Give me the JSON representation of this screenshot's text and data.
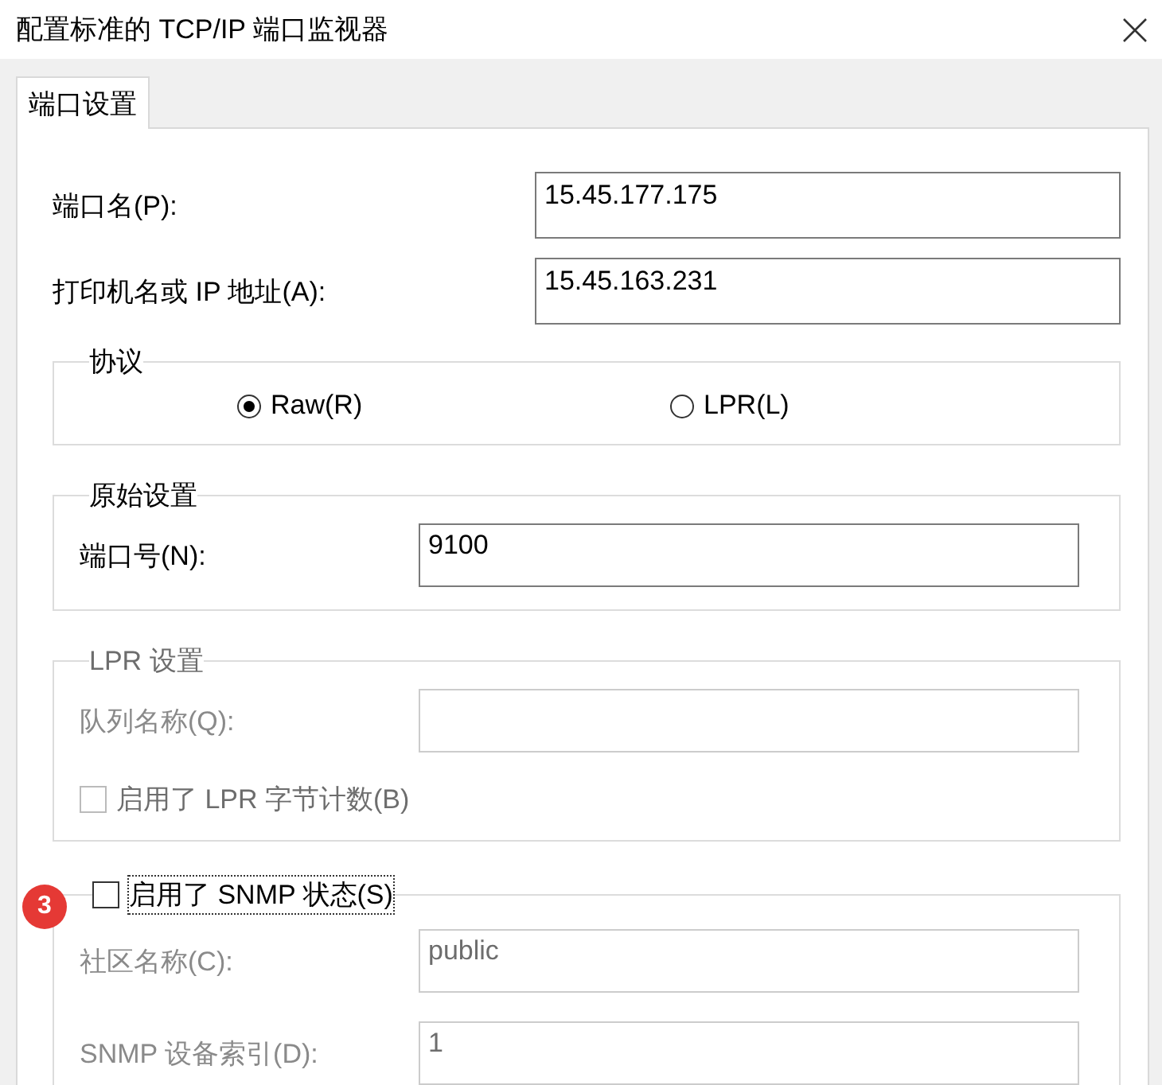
{
  "window": {
    "title": "配置标准的 TCP/IP 端口监视器"
  },
  "tabs": [
    {
      "label": "端口设置",
      "selected": true
    }
  ],
  "fields": [
    {
      "label": "端口名(P):",
      "value": "15.45.177.175"
    },
    {
      "label": "打印机名或 IP 地址(A):",
      "value": "15.45.163.231"
    }
  ],
  "protocol": {
    "title": "协议",
    "options": [
      {
        "label": "Raw(R)",
        "selected": true
      },
      {
        "label": "LPR(L)",
        "selected": false
      }
    ]
  },
  "raw_settings": {
    "title": "原始设置",
    "fields": [
      {
        "label": "端口号(N):",
        "value": "9100",
        "disabled": false
      }
    ]
  },
  "lpr_settings": {
    "title": "LPR 设置",
    "fields": [
      {
        "label": "队列名称(Q):",
        "disabled": true
      }
    ],
    "checkbox": {
      "label": "启用了 LPR 字节计数(B)",
      "checked": false,
      "disabled": true
    }
  },
  "snmp": {
    "badge": "3",
    "checkbox": {
      "label": "启用了 SNMP 状态(S)",
      "checked": false,
      "disabled": false
    },
    "fields": [
      {
        "label": "社区名称(C):",
        "value": "public",
        "disabled": true
      },
      {
        "label": "SNMP 设备索引(D):",
        "value": "1",
        "disabled": true
      }
    ]
  }
}
